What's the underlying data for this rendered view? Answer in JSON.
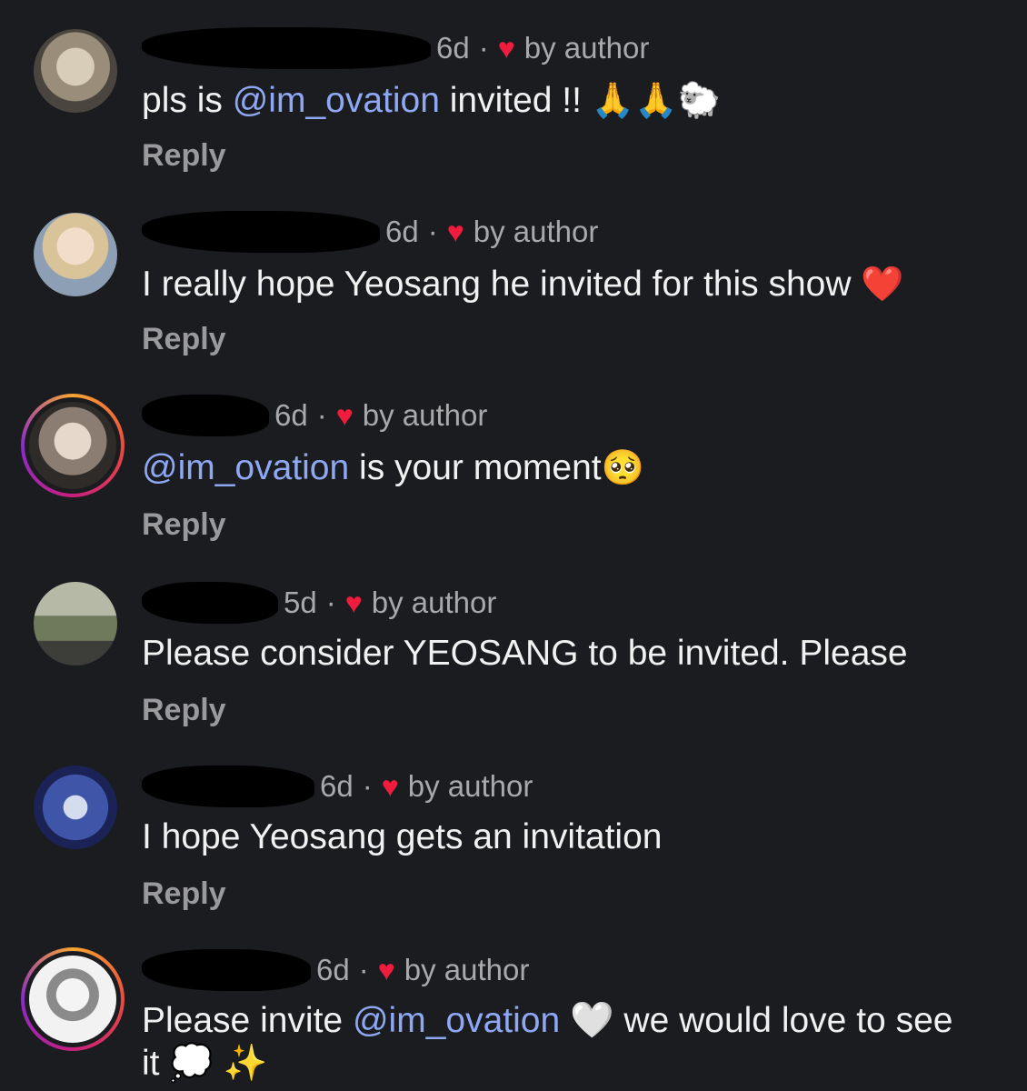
{
  "comments": [
    {
      "time": "6d",
      "by_author": "by author",
      "text_before": "pls is ",
      "mention": "@im_ovation",
      "text_after": " invited !! ",
      "emoji": "🙏🙏🐑",
      "reply": "Reply"
    },
    {
      "time": "6d",
      "by_author": "by author",
      "text_before": "I really hope Yeosang he invited for this show ",
      "mention": "",
      "text_after": "",
      "emoji": "❤️",
      "reply": "Reply"
    },
    {
      "time": "6d",
      "by_author": "by author",
      "text_before": "",
      "mention": "@im_ovation",
      "text_after": " is your moment",
      "emoji": "🥺",
      "reply": "Reply"
    },
    {
      "time": "5d",
      "by_author": "by author",
      "text_before": "Please consider YEOSANG to be invited. Please",
      "mention": "",
      "text_after": "",
      "emoji": "",
      "reply": "Reply"
    },
    {
      "time": "6d",
      "by_author": "by author",
      "text_before": "I hope Yeosang gets an invitation",
      "mention": "",
      "text_after": "",
      "emoji": "",
      "reply": "Reply"
    },
    {
      "time": "6d",
      "by_author": "by author",
      "text_before": "Please invite ",
      "mention": "@im_ovation",
      "text_after": " 🤍  we would love to see",
      "line2": "it 💭 ✨",
      "emoji": "",
      "reply": ""
    }
  ],
  "colors": {
    "background": "#1b1c1f",
    "mention": "#8fa8f5",
    "heart": "#ee1d3d"
  }
}
